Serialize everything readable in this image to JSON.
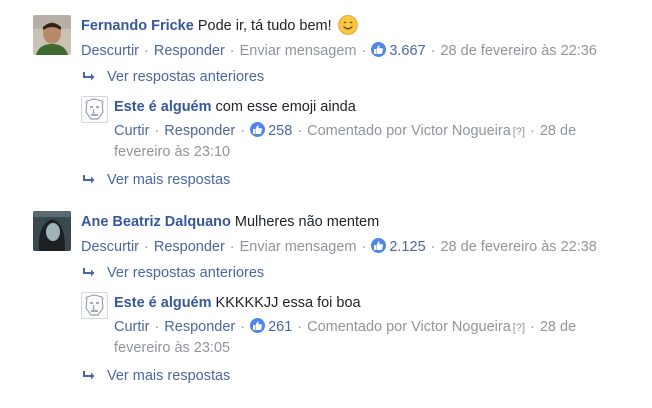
{
  "comments": [
    {
      "author": "Fernando Fricke",
      "text": "Pode ir, tá tudo bem!",
      "emoji": "😊",
      "actions": {
        "unlike": "Descurtir",
        "reply": "Responder",
        "message": "Enviar mensagem"
      },
      "likes": "3.667",
      "date": "28 de fevereiro às 22:36",
      "view_previous": "Ver respostas anteriores",
      "reply": {
        "author": "Este é alguém",
        "text": "com esse emoji ainda",
        "actions": {
          "like": "Curtir",
          "reply": "Responder"
        },
        "likes": "258",
        "commented_by": "Comentado por Victor Nogueira",
        "help": "[?]",
        "date_part1": "28 de",
        "date_part2": "fevereiro às 23:10"
      },
      "view_more": "Ver mais respostas"
    },
    {
      "author": "Ane Beatriz Dalquano",
      "text": "Mulheres não mentem",
      "actions": {
        "unlike": "Descurtir",
        "reply": "Responder",
        "message": "Enviar mensagem"
      },
      "likes": "2.125",
      "date": "28 de fevereiro às 22:38",
      "view_previous": "Ver respostas anteriores",
      "reply": {
        "author": "Este é alguém",
        "text": "KKKKKJJ essa foi boa",
        "actions": {
          "like": "Curtir",
          "reply": "Responder"
        },
        "likes": "261",
        "commented_by": "Comentado por Victor Nogueira",
        "help": "[?]",
        "date_part1": "28 de",
        "date_part2": "fevereiro às 23:05"
      },
      "view_more": "Ver mais respostas"
    }
  ],
  "separator": "·",
  "icons": {
    "like": "thumbs-up-icon",
    "reply_arrow": "reply-arrow-icon",
    "emoji": "smiling-face-icon"
  },
  "colors": {
    "link": "#4b67a1",
    "name": "#365899",
    "meta": "#90949c",
    "like_badge": "#4e86ea"
  }
}
